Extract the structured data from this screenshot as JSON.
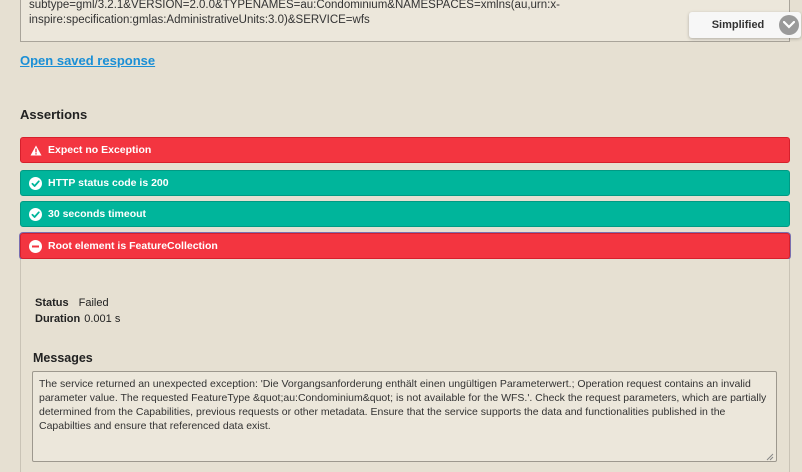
{
  "request": {
    "line1": "subtype=gml/3.2.1&VERSION=2.0.0&TYPENAMES=au:Condominium&NAMESPACES=xmlns(au,urn:x-",
    "line2": "inspire:specification:gmlas:AdministrativeUnits:3.0)&SERVICE=wfs"
  },
  "view_mode": {
    "selected": "Simplified",
    "icon": "chevron-down-icon"
  },
  "open_saved_response": "Open saved response",
  "assertions": {
    "title": "Assertions",
    "items": [
      {
        "label": "Expect no Exception",
        "status": "failed",
        "icon": "warning-icon"
      },
      {
        "label": "HTTP status code is 200",
        "status": "passed",
        "icon": "check-circle-icon"
      },
      {
        "label": "30 seconds timeout",
        "status": "passed",
        "icon": "check-circle-icon"
      },
      {
        "label": "Root element is FeatureCollection",
        "status": "failed",
        "icon": "minus-circle-icon"
      }
    ]
  },
  "details": {
    "status_label": "Status",
    "status_value": "Failed",
    "duration_label": "Duration",
    "duration_value": "0.001 s",
    "messages_title": "Messages",
    "message_text": "The service returned an unexpected exception: 'Die Vorgangsanforderung enthält einen ungültigen Parameterwert.; Operation request contains an invalid parameter value. The requested FeatureType &quot;au:Condominium&quot; is not available for the WFS.'. Check the request parameters, which are partially determined from the Capabilities, previous requests or other metadata. Ensure that the service supports the data and functionalities published in the Capabilties and ensure that referenced data exist."
  },
  "colors": {
    "failed": "#f33540",
    "passed": "#00b59b",
    "link": "#1a8fd6",
    "background": "#e6e0d2"
  }
}
